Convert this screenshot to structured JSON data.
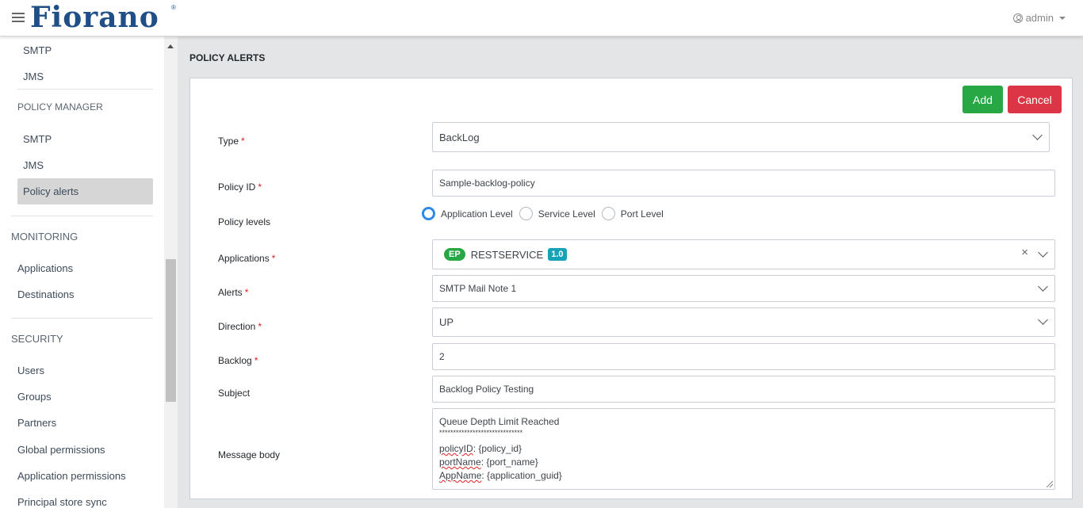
{
  "header": {
    "logo_text": "Fiorano",
    "logo_mark": "®",
    "user_label": "admin"
  },
  "sidebar": {
    "smtp_top": "SMTP",
    "jms_top": "JMS",
    "policy_manager_heading": "POLICY MANAGER",
    "pm_smtp": "SMTP",
    "pm_jms": "JMS",
    "pm_policy_alerts": "Policy alerts",
    "monitoring_heading": "MONITORING",
    "applications": "Applications",
    "destinations": "Destinations",
    "security_heading": "SECURITY",
    "users": "Users",
    "groups": "Groups",
    "partners": "Partners",
    "global_permissions": "Global permissions",
    "application_permissions": "Application permissions",
    "principal_store_sync": "Principal store sync"
  },
  "page": {
    "title": "POLICY ALERTS",
    "add_label": "Add",
    "cancel_label": "Cancel"
  },
  "form": {
    "required_mark": "*",
    "type": {
      "label": "Type",
      "value": "BackLog"
    },
    "policy_id": {
      "label": "Policy ID",
      "value": "Sample-backlog-policy"
    },
    "policy_levels": {
      "label": "Policy levels",
      "options": [
        "Application Level",
        "Service Level",
        "Port Level"
      ],
      "selected": "Application Level"
    },
    "applications": {
      "label": "Applications",
      "badge": "EP",
      "value": "RESTSERVICE",
      "version": "1.0",
      "clear": "×"
    },
    "alerts": {
      "label": "Alerts",
      "value": "SMTP Mail Note 1"
    },
    "direction": {
      "label": "Direction",
      "value": "UP"
    },
    "backlog": {
      "label": "Backlog",
      "value": "2"
    },
    "subject": {
      "label": "Subject",
      "value": "Backlog Policy Testing"
    },
    "message_body": {
      "label": "Message body",
      "line1": "Queue Depth Limit Reached",
      "line2": "******************************",
      "line3_key": "policyID",
      "line3_val": ": {policy_id}",
      "line4_key": "portName",
      "line4_val": ": {port_name}",
      "line5_key": "AppName",
      "line5_val": ": {application_guid}"
    }
  },
  "colors": {
    "add": "#28a745",
    "cancel": "#dc3545",
    "logo": "#1f4f86",
    "radio_selected": "#2e8ae6",
    "version_badge": "#17a2b8"
  }
}
